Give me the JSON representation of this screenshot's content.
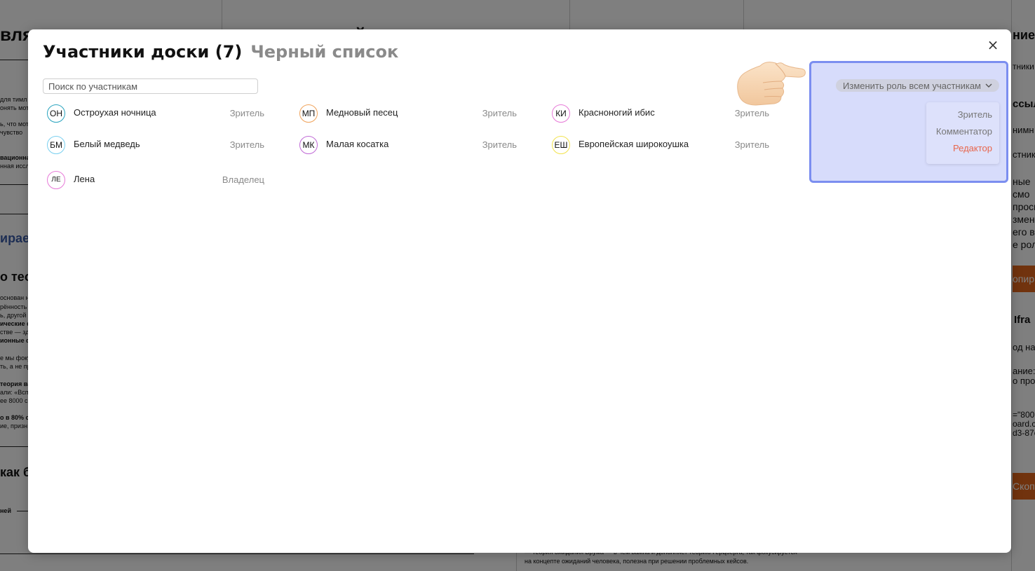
{
  "background": {
    "heading": "вляем управленческие карты для своей команды",
    "snippets": [
      "для тимл",
      "онять мот",
      "ь, что мот",
      "чувство",
      "вационна",
      "нная иссл",
      "ираемо",
      "о теори",
      "основан н",
      "рённость -",
      "ь, другой",
      "ические фа",
      "стве — зде",
      "ионные ф",
      "е мы фоку",
      "ть, а не пр",
      "теория ва",
      "али: «Вспо",
      "ее 8000 с",
      "о в 80% с",
      "ие, призн",
      "как бу",
      "ней",
      "ние",
      "тники",
      "ссыл",
      "нимн",
      "стник",
      "ные",
      "смо",
      "проси",
      "змен",
      "его в",
      "е рол",
      "опир",
      "Ifra",
      "од на",
      "ание:",
      "о про",
      "=\"800",
      "oard.c",
      "d3-87e",
      "Скоп",
      "— теория ожидания Врума — в чём важна и дополняет теорию Герцберга, так фокусируется",
      "на концепте ожиданий человека, полезна при решении проблемных кейсов."
    ],
    "colors": {
      "accent": "#e3661c",
      "link": "#3b5da8"
    }
  },
  "modal": {
    "tabs": [
      {
        "label": "Участники доски (7)",
        "active": true
      },
      {
        "label": "Черный список",
        "active": false
      }
    ],
    "close_icon": "×",
    "search": {
      "placeholder": "Поиск по участникам",
      "value": ""
    },
    "members": [
      {
        "initials": "ОН",
        "name": "Остроухая ночница",
        "role": "Зритель",
        "color": "#2aa4bf"
      },
      {
        "initials": "МП",
        "name": "Медновый песец",
        "role": "Зритель",
        "color": "#f0a35b"
      },
      {
        "initials": "КИ",
        "name": "Красноногий ибис",
        "role": "Зритель",
        "color": "#e77ad8"
      },
      {
        "initials": "БМ",
        "name": "Белый медведь",
        "role": "Зритель",
        "color": "#7ad0f0"
      },
      {
        "initials": "МК",
        "name": "Малая косатка",
        "role": "Зритель",
        "color": "#c06ad6"
      },
      {
        "initials": "ЕШ",
        "name": "Европейская широкоушка",
        "role": "Зритель",
        "color": "#f2e34e"
      },
      {
        "initials": "ЛЕ",
        "name": "Лена",
        "role": "Владелец",
        "color": "#e77ad8"
      }
    ],
    "change_role_all": {
      "label": "Изменить роль всем участникам",
      "icon": "chevron-down-icon"
    },
    "role_menu": [
      {
        "label": "Зритель"
      },
      {
        "label": "Комментатор"
      },
      {
        "label": "Редактор",
        "accent": "#e8664c"
      }
    ],
    "highlight_color": "#7b8ef0"
  }
}
